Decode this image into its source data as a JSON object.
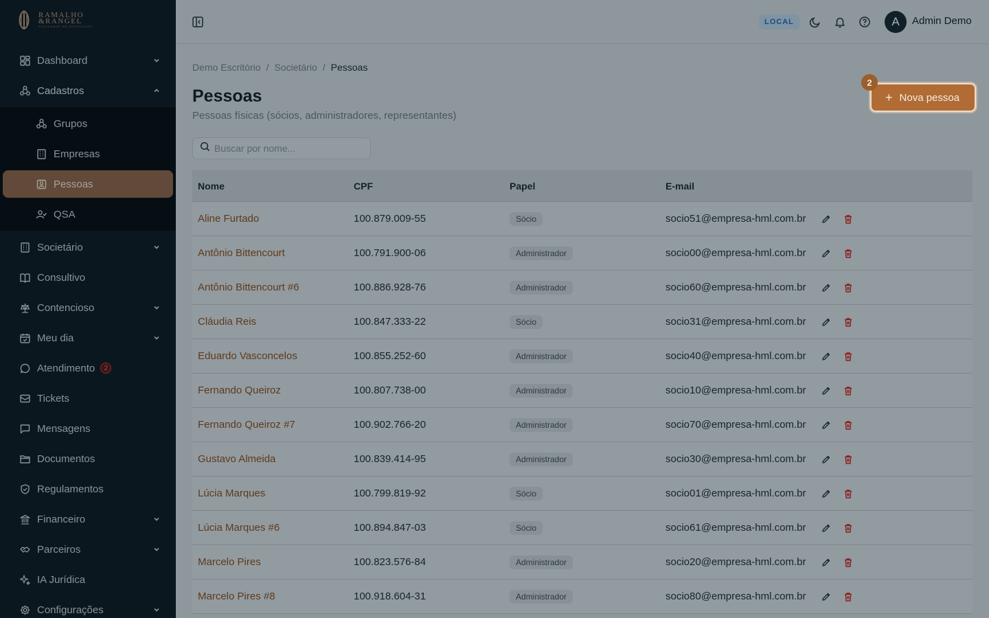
{
  "brand": {
    "line1": "RAMALHO",
    "line2": "&RANGEL",
    "line3": "SOCIEDADE DE ADVOGADOS"
  },
  "sidebar": {
    "items": [
      {
        "label": "Dashboard",
        "icon": "grid-icon",
        "has_chevron": true
      },
      {
        "label": "Cadastros",
        "icon": "network-icon",
        "has_chevron": true
      },
      {
        "label": "Societário",
        "icon": "building-icon",
        "has_chevron": true
      },
      {
        "label": "Consultivo",
        "icon": "book-icon",
        "has_chevron": false
      },
      {
        "label": "Contencioso",
        "icon": "scale-icon",
        "has_chevron": true
      },
      {
        "label": "Meu dia",
        "icon": "calendar-icon",
        "has_chevron": true
      },
      {
        "label": "Atendimento",
        "icon": "chat-icon",
        "has_chevron": false,
        "badge": "2"
      },
      {
        "label": "Tickets",
        "icon": "ticket-icon",
        "has_chevron": false
      },
      {
        "label": "Mensagens",
        "icon": "message-icon",
        "has_chevron": false
      },
      {
        "label": "Documentos",
        "icon": "folder-icon",
        "has_chevron": false
      },
      {
        "label": "Regulamentos",
        "icon": "shield-icon",
        "has_chevron": false
      },
      {
        "label": "Financeiro",
        "icon": "bank-icon",
        "has_chevron": true
      },
      {
        "label": "Parceiros",
        "icon": "handshake-icon",
        "has_chevron": true
      },
      {
        "label": "IA Jurídica",
        "icon": "sparkle-icon",
        "has_chevron": false
      },
      {
        "label": "Configurações",
        "icon": "gear-icon",
        "has_chevron": true
      }
    ],
    "subitems": [
      {
        "label": "Grupos",
        "icon": "network-icon"
      },
      {
        "label": "Empresas",
        "icon": "building-icon"
      },
      {
        "label": "Pessoas",
        "icon": "id-card-icon",
        "active": true
      },
      {
        "label": "QSA",
        "icon": "user-check-icon"
      }
    ]
  },
  "topbar": {
    "env": "LOCAL",
    "avatar_initial": "A",
    "user_name": "Admin Demo"
  },
  "breadcrumb": [
    "Demo Escritório",
    "Societário",
    "Pessoas"
  ],
  "page": {
    "title": "Pessoas",
    "subtitle": "Pessoas físicas (sócios, administradores, representantes)",
    "new_button": "Nova pessoa",
    "step_badge": "2",
    "search_placeholder": "Buscar por nome..."
  },
  "table": {
    "columns": [
      "Nome",
      "CPF",
      "Papel",
      "E-mail"
    ],
    "rows": [
      {
        "nome": "Aline Furtado",
        "cpf": "100.879.009-55",
        "papel": "Sócio",
        "email": "socio51@empresa-hml.com.br"
      },
      {
        "nome": "Antônio Bittencourt",
        "cpf": "100.791.900-06",
        "papel": "Administrador",
        "email": "socio00@empresa-hml.com.br"
      },
      {
        "nome": "Antônio Bittencourt #6",
        "cpf": "100.886.928-76",
        "papel": "Administrador",
        "email": "socio60@empresa-hml.com.br"
      },
      {
        "nome": "Cláudia Reis",
        "cpf": "100.847.333-22",
        "papel": "Sócio",
        "email": "socio31@empresa-hml.com.br"
      },
      {
        "nome": "Eduardo Vasconcelos",
        "cpf": "100.855.252-60",
        "papel": "Administrador",
        "email": "socio40@empresa-hml.com.br"
      },
      {
        "nome": "Fernando Queiroz",
        "cpf": "100.807.738-00",
        "papel": "Administrador",
        "email": "socio10@empresa-hml.com.br"
      },
      {
        "nome": "Fernando Queiroz #7",
        "cpf": "100.902.766-20",
        "papel": "Administrador",
        "email": "socio70@empresa-hml.com.br"
      },
      {
        "nome": "Gustavo Almeida",
        "cpf": "100.839.414-95",
        "papel": "Administrador",
        "email": "socio30@empresa-hml.com.br"
      },
      {
        "nome": "Lúcia Marques",
        "cpf": "100.799.819-92",
        "papel": "Sócio",
        "email": "socio01@empresa-hml.com.br"
      },
      {
        "nome": "Lúcia Marques #6",
        "cpf": "100.894.847-03",
        "papel": "Sócio",
        "email": "socio61@empresa-hml.com.br"
      },
      {
        "nome": "Marcelo Pires",
        "cpf": "100.823.576-84",
        "papel": "Administrador",
        "email": "socio20@empresa-hml.com.br"
      },
      {
        "nome": "Marcelo Pires #8",
        "cpf": "100.918.604-31",
        "papel": "Administrador",
        "email": "socio80@empresa-hml.com.br"
      }
    ]
  },
  "colors": {
    "sidebar_bg": "#0b171e",
    "accent": "#b06c34",
    "active_nav": "#614a39",
    "link": "#5e3a1c",
    "delete": "#8a1f1f"
  }
}
